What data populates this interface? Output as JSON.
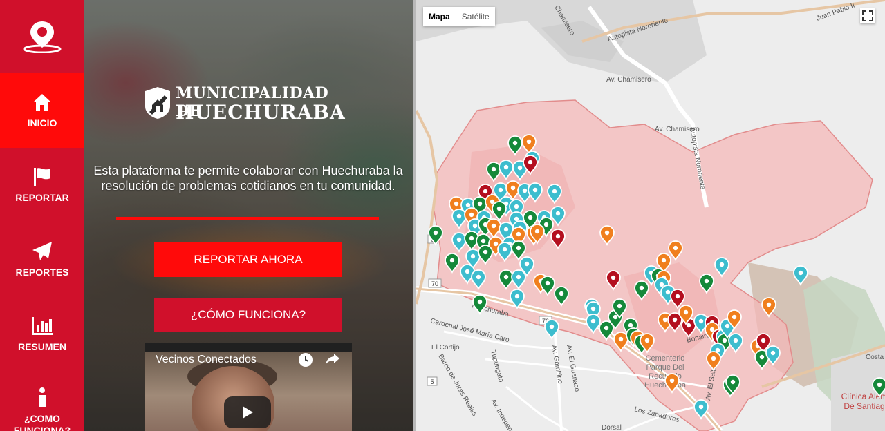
{
  "sidebar": {
    "items": [
      {
        "label": "INICIO",
        "icon": "home-icon"
      },
      {
        "label": "REPORTAR",
        "icon": "flag-icon"
      },
      {
        "label": "REPORTES",
        "icon": "paper-plane-icon"
      },
      {
        "label": "RESUMEN",
        "icon": "bar-chart-icon"
      },
      {
        "label_line1": "¿COMO",
        "label_line2": "FUNCIONA?",
        "icon": "info-icon"
      }
    ],
    "logo_icon": "map-pin-icon",
    "colors": {
      "bg": "#d0102b",
      "active": "#ff0a0a"
    }
  },
  "hero": {
    "brand_line1": "MUNICIPALIDAD DE",
    "brand_line2": "HUECHURABA",
    "intro": "Esta plataforma te permite colaborar con Huechuraba la resolución de problemas cotidianos en tu comunidad.",
    "report_button": "REPORTAR AHORA",
    "how_button": "¿CÓMO FUNCIONA?",
    "video_title": "Vecinos Conectados"
  },
  "map": {
    "type_map": "Mapa",
    "type_satellite": "Satélite",
    "labels": {
      "road1": "Autopista Nororiente",
      "road2": "Autopista Nororiente",
      "road3": "Av. Chamisero",
      "road4": "Juan Pablo II",
      "road5": "Chamisero",
      "road6": "Av. Chamisero",
      "huechuraba": "Huechuraba",
      "cardenal": "Cardenal José María Caro",
      "cortijo": "El Cortijo",
      "baron": "Baron de Juras Reales",
      "tupungato": "Tupungato",
      "gambino": "Av. Gambino",
      "guanaco": "Av. El Guanaco",
      "independencia": "Av. Independencia",
      "zapadores": "Los Zapadores",
      "dorsal": "Dorsal",
      "cementerio1": "Cementerio",
      "cementerio2": "Parque Del",
      "cementerio3": "Recuerdo",
      "cementerio4": "Huechuraba",
      "clinica1": "Clínica Alem",
      "clinica2": "De Santiag",
      "costa": "Costa",
      "salto": "Av. El Salto",
      "bonaire": "Bonaire",
      "r70a": "70",
      "r70b": "70",
      "r5a": "5",
      "r5b": "5"
    },
    "marker_colors": {
      "teal": "#3dbdce",
      "green": "#15893a",
      "orange": "#f07f1e",
      "red": "#b40f1f"
    }
  }
}
